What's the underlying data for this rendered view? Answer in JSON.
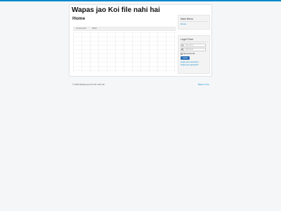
{
  "site": {
    "title": "Wapas jao Koi file nahi hai"
  },
  "main": {
    "page_title": "Home",
    "breadcrumb": {
      "prefix": "You are here:",
      "current": "Home"
    }
  },
  "main_menu": {
    "title": "Main Menu",
    "items": [
      {
        "label": "Home"
      }
    ]
  },
  "login_form": {
    "title": "Login Form",
    "username_placeholder": "Username",
    "password_placeholder": "Password",
    "remember_label": "Remember Me",
    "login_button": "Log in",
    "forgot_username": "Forgot your username?",
    "forgot_password": "Forgot your password?"
  },
  "footer": {
    "copyright": "© 2023 Wapas jao Koi file nahi hai",
    "back_to_top": "Back to Top"
  },
  "colors": {
    "accent": "#0088cc",
    "button": "#2a6db5",
    "background": "#f4f6f7"
  }
}
